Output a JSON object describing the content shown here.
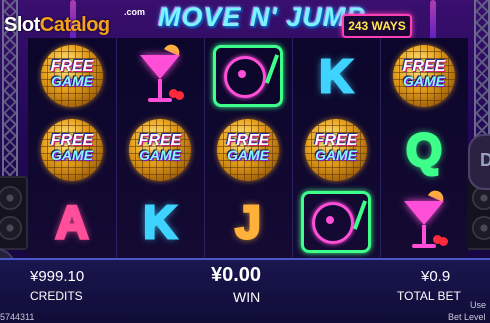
{
  "watermark": {
    "brand_white": "Slot",
    "brand_orange": "Catalog",
    "suffix": ".com"
  },
  "game": {
    "logo": "MOVE N' JUMP",
    "ways_badge": "243 WAYS"
  },
  "reels": [
    [
      "free-game",
      "free-game",
      "A"
    ],
    [
      "cocktail",
      "free-game",
      "K"
    ],
    [
      "turntable",
      "free-game",
      "J"
    ],
    [
      "K",
      "free-game",
      "turntable"
    ],
    [
      "free-game",
      "Q",
      "cocktail"
    ]
  ],
  "free_game_text": {
    "line1": "FREE",
    "line2": "GAME"
  },
  "side_button": {
    "glyph": "D"
  },
  "bottom_bar": {
    "credits_value": "¥999.10",
    "credits_label": "CREDITS",
    "win_value": "¥0.00",
    "win_label": "WIN",
    "bet_value": "¥0.9",
    "bet_label": "TOTAL BET",
    "session_id": "5744311",
    "bet_level_label": "Bet Level",
    "corner_text": "Use"
  },
  "colors": {
    "accent_pink": "#ff3fb6",
    "accent_cyan": "#3fd3ff",
    "accent_green": "#3dff8a",
    "accent_orange": "#f7a21b"
  }
}
